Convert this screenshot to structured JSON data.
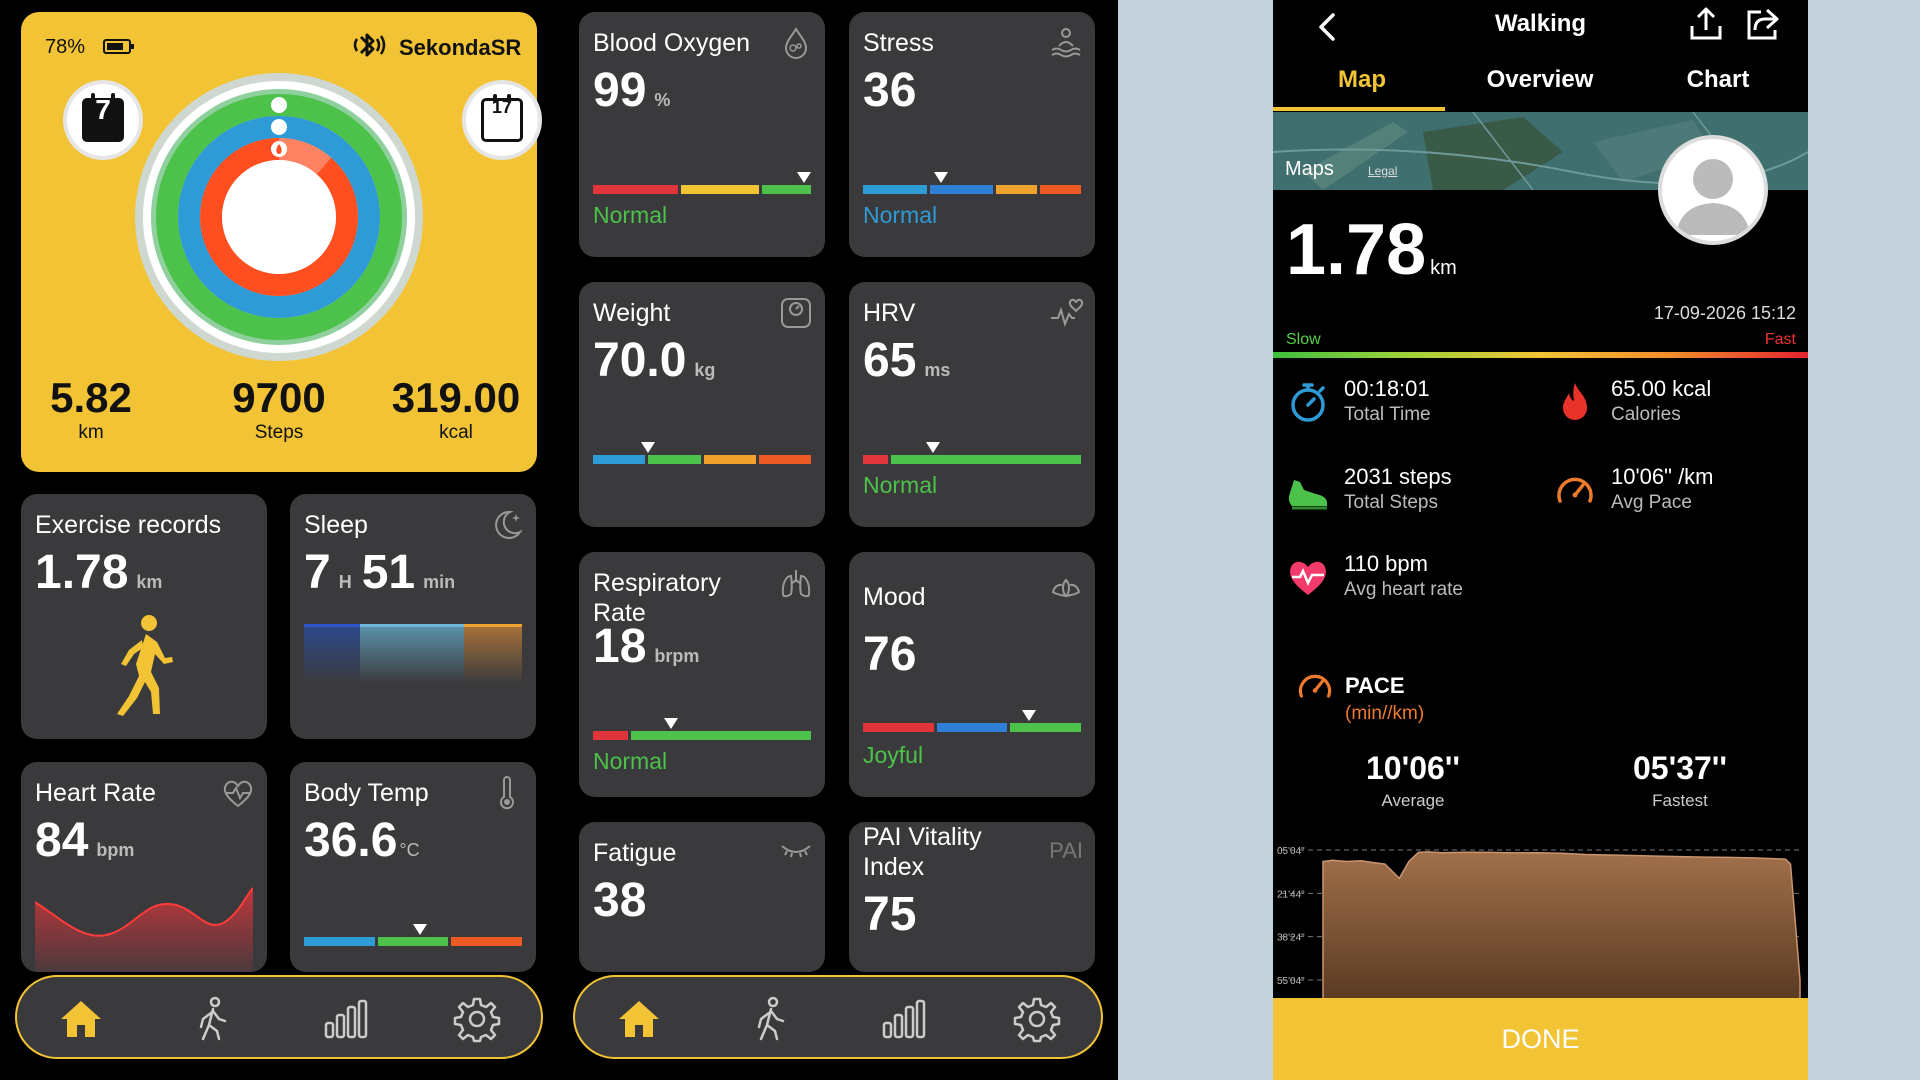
{
  "summary": {
    "battery": "78%",
    "device_name": "SekondaSR",
    "cal_left_day": "7",
    "cal_right_day": "17",
    "distance_value": "5.82",
    "distance_unit": "km",
    "steps_value": "9700",
    "steps_unit": "Steps",
    "calories_value": "319.00",
    "calories_unit": "kcal",
    "ring_colors": [
      "#8fd09e",
      "#4cc24a",
      "#2f9bd6",
      "#ff4e1f"
    ]
  },
  "left_cards": {
    "exercise": {
      "title": "Exercise records",
      "value": "1.78",
      "unit": "km"
    },
    "sleep": {
      "title": "Sleep",
      "hours": "7",
      "h_unit": "H",
      "minutes": "51",
      "min_unit": "min"
    },
    "heart": {
      "title": "Heart Rate",
      "value": "84",
      "unit": "bpm"
    },
    "body_temp": {
      "title": "Body Temp",
      "value": "36.6",
      "unit": "°C",
      "level": 0.53
    }
  },
  "middle_cards": {
    "blood_oxygen": {
      "title": "Blood Oxygen",
      "value": "99",
      "unit": "%",
      "status": "Normal",
      "level": 0.97
    },
    "stress": {
      "title": "Stress",
      "value": "36",
      "status": "Normal",
      "level": 0.36
    },
    "weight": {
      "title": "Weight",
      "value": "70.0",
      "unit": "kg",
      "level": 0.25
    },
    "hrv": {
      "title": "HRV",
      "value": "65",
      "unit": "ms",
      "status": "Normal",
      "level": 0.32
    },
    "respiratory": {
      "title": "Respiratory Rate",
      "value": "18",
      "unit": "brpm",
      "status": "Normal",
      "level": 0.36
    },
    "mood": {
      "title": "Mood",
      "value": "76",
      "status": "Joyful",
      "level": 0.76
    },
    "fatigue": {
      "title": "Fatigue",
      "value": "38"
    },
    "pai": {
      "title": "PAI Vitality Index",
      "value": "75",
      "icon_text": "PAI"
    }
  },
  "walking": {
    "title": "Walking",
    "tabs": [
      "Map",
      "Overview",
      "Chart"
    ],
    "active_tab": "Map",
    "maps_brand": "Maps",
    "maps_legal": "Legal",
    "distance": "1.78",
    "distance_unit": "km",
    "datetime": "17-09-2026 15:12",
    "slow_label": "Slow",
    "fast_label": "Fast",
    "metrics": {
      "time": {
        "value": "00:18:01",
        "label": "Total Time"
      },
      "calories": {
        "value": "65.00 kcal",
        "label": "Calories"
      },
      "steps": {
        "value": "2031 steps",
        "label": "Total Steps"
      },
      "pace": {
        "value": "10'06\" /km",
        "label": "Avg Pace"
      },
      "heart": {
        "value": "110 bpm",
        "label": "Avg heart rate"
      }
    },
    "pace_title": "PACE",
    "pace_unit": "(min//km)",
    "pace_average": "10'06''",
    "pace_average_label": "Average",
    "pace_fastest": "05'37''",
    "pace_fastest_label": "Fastest",
    "done_label": "DONE"
  },
  "chart_data": {
    "type": "area",
    "y_ticks": [
      "05'04\"",
      "21'44\"",
      "38'24\"",
      "55'04\""
    ],
    "x": [
      0,
      0.02,
      0.05,
      0.08,
      0.1,
      0.13,
      0.16,
      0.18,
      0.2,
      0.22,
      0.25,
      0.3,
      0.35,
      0.4,
      0.45,
      0.5,
      0.55,
      0.6,
      0.65,
      0.7,
      0.75,
      0.8,
      0.85,
      0.9,
      0.95,
      0.97,
      0.98,
      1.0
    ],
    "values": [
      9.5,
      9.0,
      9.5,
      9.2,
      9.8,
      10.5,
      16,
      9.5,
      6.0,
      5.8,
      6.1,
      5.9,
      6.0,
      6.2,
      6.1,
      6.3,
      6.8,
      7.0,
      7.2,
      7.4,
      7.6,
      7.8,
      7.9,
      8.1,
      8.4,
      8.6,
      10.5,
      55
    ],
    "ylim": [
      5.07,
      55.07
    ],
    "fill_color": "#a0704a"
  },
  "nav": [
    "home",
    "walk",
    "stats",
    "settings"
  ],
  "nav_active_color": "#f1c335"
}
